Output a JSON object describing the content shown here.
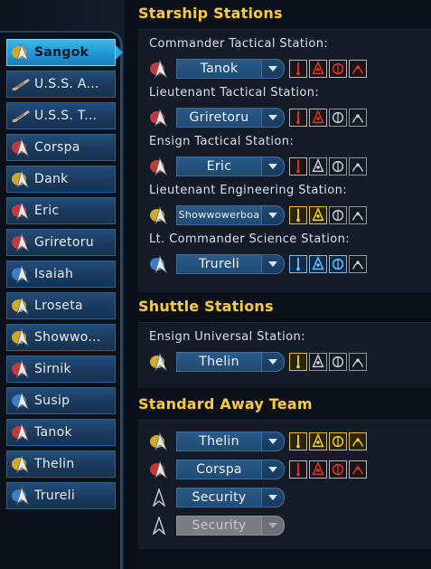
{
  "sidebar": {
    "items": [
      {
        "label": "Sangok",
        "icon": "delta-badge-gold-icon",
        "selected": true
      },
      {
        "label": "U.S.S. A...",
        "icon": "ship-icon",
        "selected": false
      },
      {
        "label": "U.S.S. T...",
        "icon": "ship-icon",
        "selected": false
      },
      {
        "label": "Corspa",
        "icon": "delta-badge-red-icon",
        "selected": false
      },
      {
        "label": "Dank",
        "icon": "delta-badge-gold-icon",
        "selected": false
      },
      {
        "label": "Eric",
        "icon": "delta-badge-red-icon",
        "selected": false
      },
      {
        "label": "Griretoru",
        "icon": "delta-badge-red-icon",
        "selected": false
      },
      {
        "label": "Isaiah",
        "icon": "delta-badge-blue-icon",
        "selected": false
      },
      {
        "label": "Lroseta",
        "icon": "delta-badge-gold-icon",
        "selected": false
      },
      {
        "label": "Showwo...",
        "icon": "delta-badge-gold-icon",
        "selected": false
      },
      {
        "label": "Sirnik",
        "icon": "delta-badge-red-icon",
        "selected": false
      },
      {
        "label": "Susip",
        "icon": "delta-badge-blue-icon",
        "selected": false
      },
      {
        "label": "Tanok",
        "icon": "delta-badge-red-icon",
        "selected": false
      },
      {
        "label": "Thelin",
        "icon": "delta-badge-gold-icon",
        "selected": false
      },
      {
        "label": "Trureli",
        "icon": "delta-badge-blue-icon",
        "selected": false
      }
    ]
  },
  "starship": {
    "title": "Starship Stations",
    "stations": [
      {
        "label": "Commander Tactical Station:",
        "officer": "Tanok",
        "badge": "delta-badge-red-icon",
        "abilities": [
          "tac",
          "tac",
          "tac",
          "tac"
        ]
      },
      {
        "label": "Lieutenant Tactical Station:",
        "officer": "Griretoru",
        "badge": "delta-badge-red-icon",
        "abilities": [
          "tac",
          "tac",
          "empty",
          "empty"
        ]
      },
      {
        "label": "Ensign Tactical Station:",
        "officer": "Eric",
        "badge": "delta-badge-red-icon",
        "abilities": [
          "tac",
          "empty",
          "empty",
          "empty"
        ]
      },
      {
        "label": "Lieutenant Engineering Station:",
        "officer": "Showwowerboa",
        "badge": "delta-badge-gold-icon",
        "abilities": [
          "eng",
          "eng",
          "empty",
          "empty"
        ]
      },
      {
        "label": "Lt. Commander Science Station:",
        "officer": "Trureli",
        "badge": "delta-badge-blue-icon",
        "abilities": [
          "sci",
          "sci",
          "sci",
          "empty"
        ]
      }
    ]
  },
  "shuttle": {
    "title": "Shuttle Stations",
    "stations": [
      {
        "label": "Ensign Universal Station:",
        "officer": "Thelin",
        "badge": "delta-badge-gold-icon",
        "abilities": [
          "eng",
          "empty",
          "empty",
          "empty"
        ]
      }
    ]
  },
  "away": {
    "title": "Standard Away Team",
    "members": [
      {
        "officer": "Thelin",
        "badge": "delta-badge-gold-icon",
        "abilities": [
          "eng",
          "eng",
          "eng",
          "eng"
        ],
        "disabled": false
      },
      {
        "officer": "Corspa",
        "badge": "delta-badge-red-icon",
        "abilities": [
          "tac",
          "tac",
          "tac",
          "tac"
        ],
        "disabled": false
      },
      {
        "officer": "Security",
        "badge": "delta-outline-icon",
        "abilities": [],
        "disabled": false
      },
      {
        "officer": "Security",
        "badge": "delta-outline-icon",
        "abilities": [],
        "disabled": true
      }
    ]
  },
  "colors": {
    "accent_title": "#f4c94c",
    "selected_item": "#2aa5e0",
    "tactical": "#d03a2a",
    "engineering": "#e0c030",
    "science": "#3a8fd6"
  }
}
